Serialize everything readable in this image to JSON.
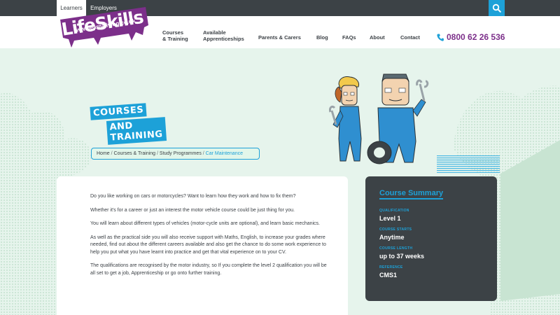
{
  "topbar": {
    "tabs": [
      "Learners",
      "Employers"
    ],
    "search_icon": "search-icon"
  },
  "header": {
    "logo": {
      "name": "LifeSkills",
      "url": "www.learnaliving.co.uk"
    },
    "nav": [
      {
        "line1": "Courses",
        "line2": "& Training"
      },
      {
        "line1": "Available",
        "line2": "Apprenticeships"
      },
      {
        "line1": "Parents & Carers",
        "line2": ""
      },
      {
        "line1": "Blog",
        "line2": ""
      },
      {
        "line1": "FAQs",
        "line2": ""
      },
      {
        "line1": "About",
        "line2": ""
      },
      {
        "line1": "Contact",
        "line2": ""
      }
    ],
    "phone": "0800 62 26 536",
    "phone_icon": "phone-icon"
  },
  "hero": {
    "badge_line1": "COURSES",
    "badge_line2": "AND TRAINING"
  },
  "breadcrumb": [
    "Home",
    "Courses & Training",
    "Study Programmes",
    "Car Maintenance"
  ],
  "content": {
    "paragraphs": [
      "Do you like working on cars or motorcycles? Want to learn how they work and how to fix them?",
      "Whether it's for a career or just an interest the motor vehicle course could be just thing for you.",
      "You will learn about different types of vehicles (motor-cycle units are optional), and learn basic mechanics.",
      "As well as the practical side you will also receive support with Maths, English, to increase your grades where needed, find out about the different careers available and also get the chance to do some work experience to help you put what you have learnt into practice and get that vital experience on to your CV.",
      "The qualifications are recognised by the motor industry, so If you complete the level 2 qualification you will be all set to get a job, Apprenticeship or go onto further training."
    ]
  },
  "summary": {
    "title": "Course Summary",
    "items": [
      {
        "label": "QUALIFICATION",
        "value": "Level 1"
      },
      {
        "label": "COURSE STARTS",
        "value": "Anytime"
      },
      {
        "label": "COURSE LENGTH",
        "value": "up to 37 weeks"
      },
      {
        "label": "REFERENCE",
        "value": "CMS1"
      }
    ]
  },
  "colors": {
    "accent": "#1da1d8",
    "brand_purple": "#7c2f8a",
    "dark": "#3c4246",
    "background": "#e6f4ec"
  }
}
